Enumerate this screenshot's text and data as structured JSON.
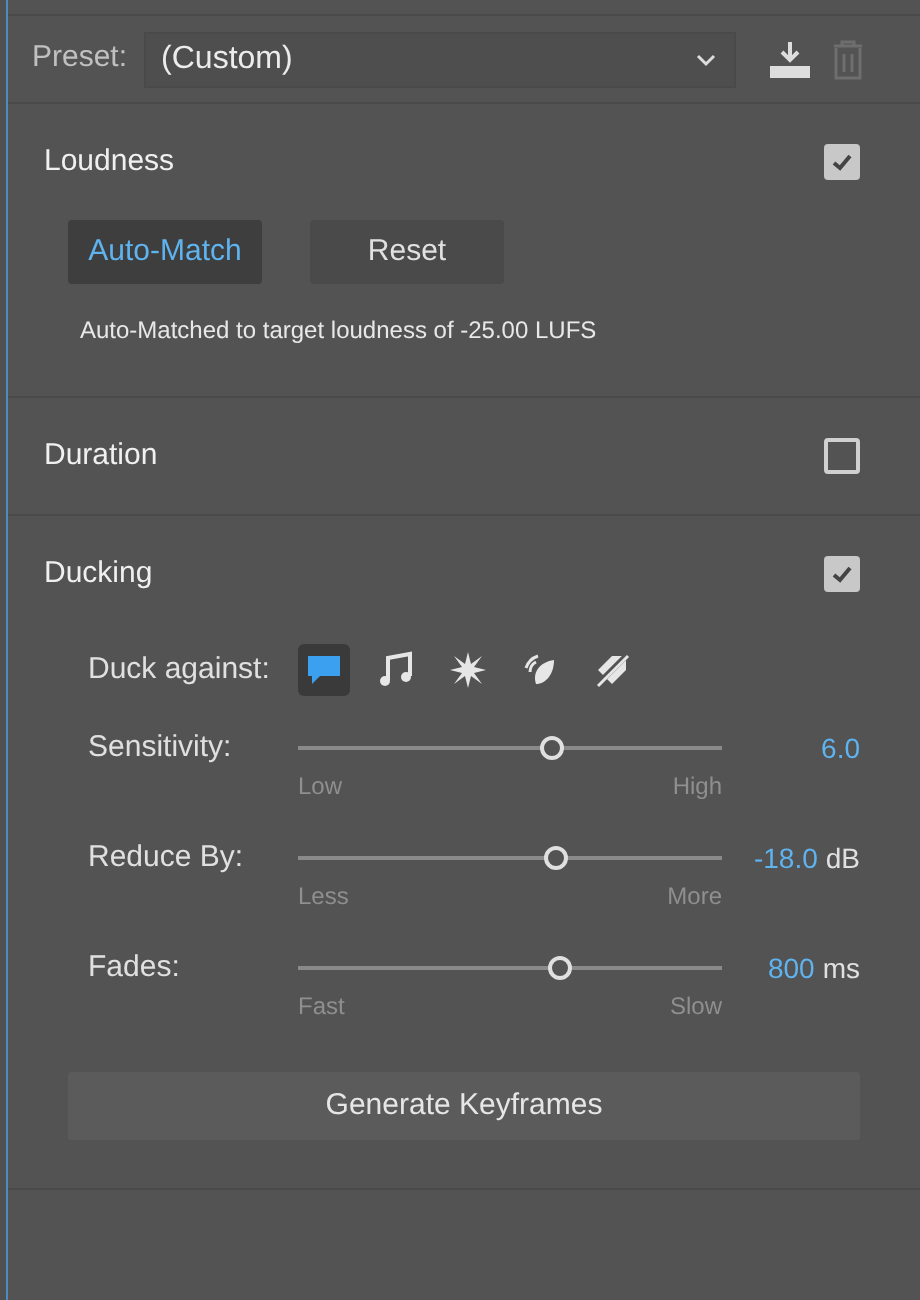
{
  "preset": {
    "label": "Preset:",
    "value": "(Custom)"
  },
  "sections": [
    {
      "kind": "loudness",
      "title": "Loudness",
      "checked": true,
      "buttons": [
        {
          "label": "Auto-Match",
          "selected": true
        },
        {
          "label": "Reset",
          "selected": false
        }
      ],
      "note": "Auto-Matched to target loudness of -25.00 LUFS"
    },
    {
      "kind": "duration",
      "title": "Duration",
      "checked": false
    },
    {
      "kind": "ducking",
      "title": "Ducking",
      "checked": true,
      "duck_against": {
        "label": "Duck against:",
        "options": [
          {
            "kind": "bubble",
            "selected": true
          },
          {
            "kind": "note",
            "selected": false
          },
          {
            "kind": "burst",
            "selected": false
          },
          {
            "kind": "leaf",
            "selected": false
          },
          {
            "kind": "tag",
            "selected": false
          }
        ]
      },
      "sliders": [
        {
          "label": "Sensitivity:",
          "level": 0.6,
          "min_label": "Low",
          "max_label": "High",
          "value": "6.0"
        },
        {
          "label": "Reduce By:",
          "level": 0.61,
          "min_label": "Less",
          "max_label": "More",
          "value": "-18.0",
          "unit": "dB"
        },
        {
          "label": "Fades:",
          "level": 0.62,
          "min_label": "Fast",
          "max_label": "Slow",
          "value": "800",
          "unit": "ms"
        }
      ],
      "action": "Generate Keyframes"
    }
  ]
}
